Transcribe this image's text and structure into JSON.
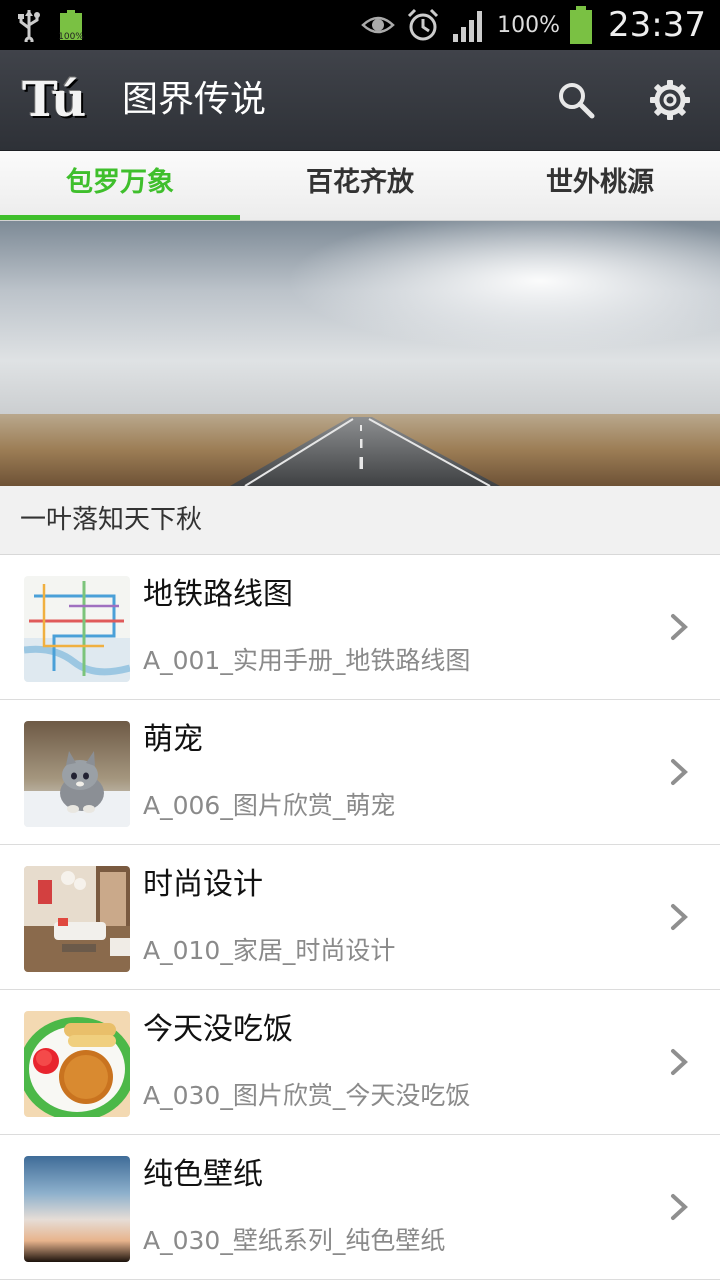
{
  "status_bar": {
    "battery_small_label": "100%",
    "battery_percent": "100%",
    "time": "23:37",
    "icons": [
      "usb-icon",
      "battery-icon",
      "eye-icon",
      "alarm-icon",
      "signal-icon",
      "battery-full-icon"
    ]
  },
  "action_bar": {
    "logo_text": "Tú",
    "title": "图界传说",
    "icons": [
      "search-icon",
      "gear-icon"
    ]
  },
  "tabs": [
    {
      "label": "包罗万象",
      "active": true
    },
    {
      "label": "百花齐放",
      "active": false
    },
    {
      "label": "世外桃源",
      "active": false
    }
  ],
  "accent_color": "#3fbf2c",
  "section_header": "一叶落知天下秋",
  "items": [
    {
      "title": "地铁路线图",
      "subtitle": "A_001_实用手册_地铁路线图",
      "thumb": "subway-map-thumbnail"
    },
    {
      "title": "萌宠",
      "subtitle": "A_006_图片欣赏_萌宠",
      "thumb": "kitten-thumbnail"
    },
    {
      "title": "时尚设计",
      "subtitle": "A_010_家居_时尚设计",
      "thumb": "interior-thumbnail"
    },
    {
      "title": "今天没吃饭",
      "subtitle": "A_030_图片欣赏_今天没吃饭",
      "thumb": "food-plate-thumbnail"
    },
    {
      "title": "纯色壁纸",
      "subtitle": "A_030_壁纸系列_纯色壁纸",
      "thumb": "gradient-wallpaper-thumbnail"
    }
  ]
}
